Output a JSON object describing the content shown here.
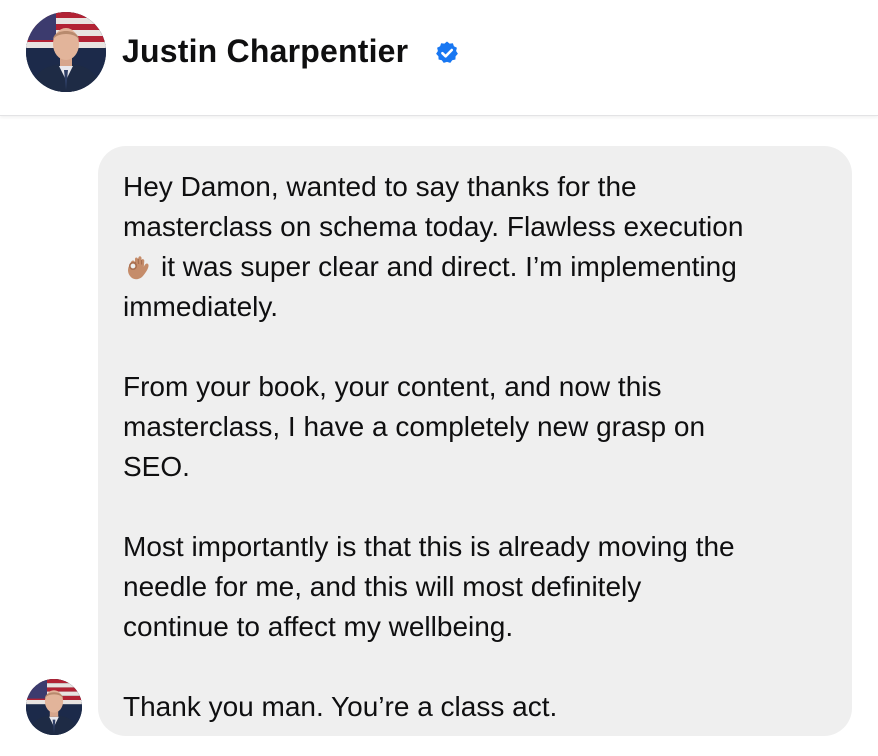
{
  "header": {
    "contact_name": "Justin Charpentier",
    "verified_icon": "verified-badge-icon",
    "verified_color": "#1877f2"
  },
  "message": {
    "sender": "Justin Charpentier",
    "bubble_color": "#efefef",
    "paragraph1": {
      "line1": "Hey Damon, wanted to say thanks for the",
      "line2": "masterclass on schema today. Flawless execution",
      "emoji": "👌🏽",
      "line3": "it was super clear and direct. I’m implementing",
      "line4": "immediately."
    },
    "paragraph2": {
      "line1": "From your book, your content, and now this",
      "line2": "masterclass, I have a completely new grasp on",
      "line3": "SEO."
    },
    "paragraph3": {
      "line1": "Most importantly is that this is already moving the",
      "line2": "needle for me, and this will most definitely",
      "line3": "continue to affect my wellbeing."
    },
    "paragraph4": {
      "line1": "Thank you man. You’re a class act."
    }
  }
}
